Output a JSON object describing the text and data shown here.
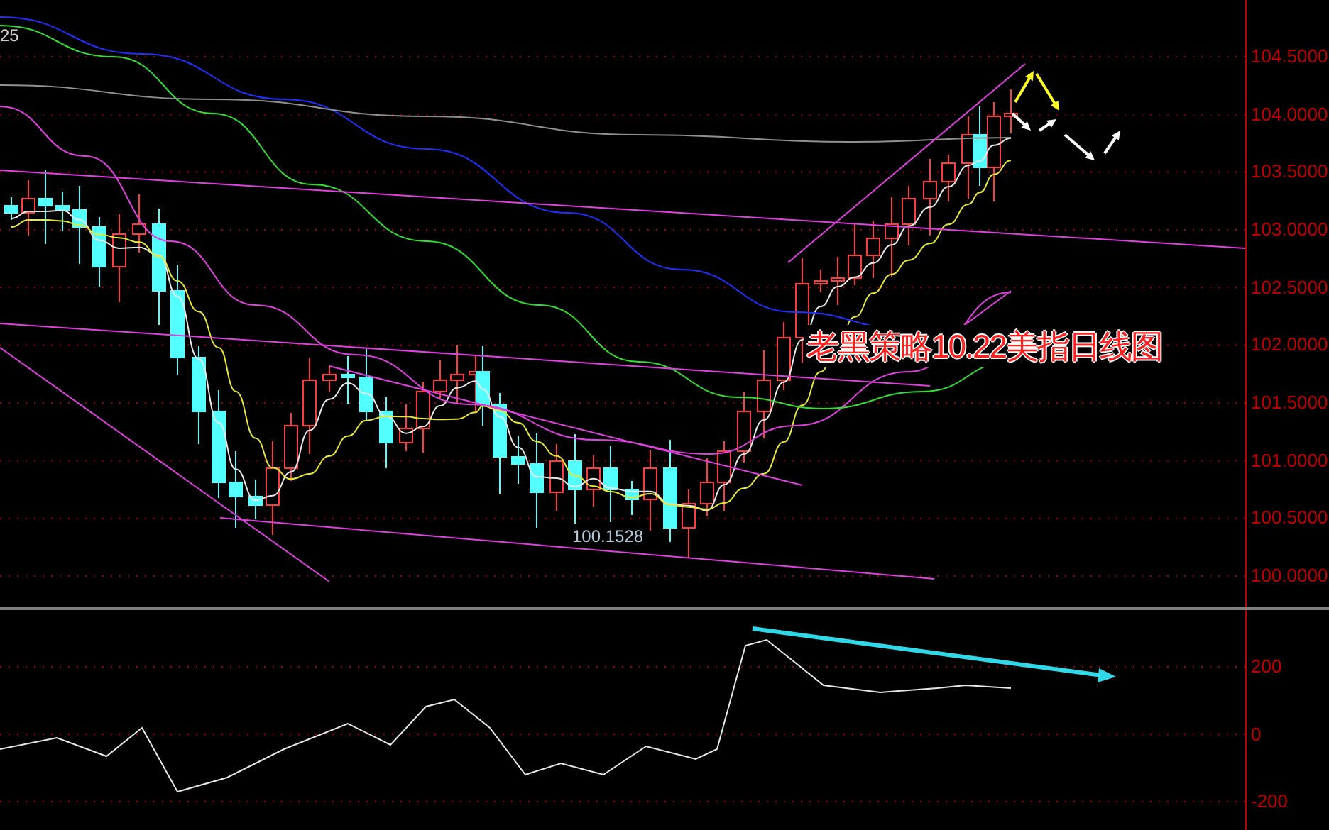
{
  "price_chart": {
    "corner_label": "25",
    "title_overlay": "老黑策略10.22美指日线图",
    "low_price_label": "100.1528",
    "axis_labels": [
      "104.5000",
      "104.0000",
      "103.5000",
      "103.0000",
      "102.5000",
      "102.0000",
      "101.5000",
      "101.0000",
      "100.5000",
      "100.0000"
    ]
  },
  "indicator_panel": {
    "axis_labels": [
      "200",
      "0",
      "-200"
    ]
  }
}
